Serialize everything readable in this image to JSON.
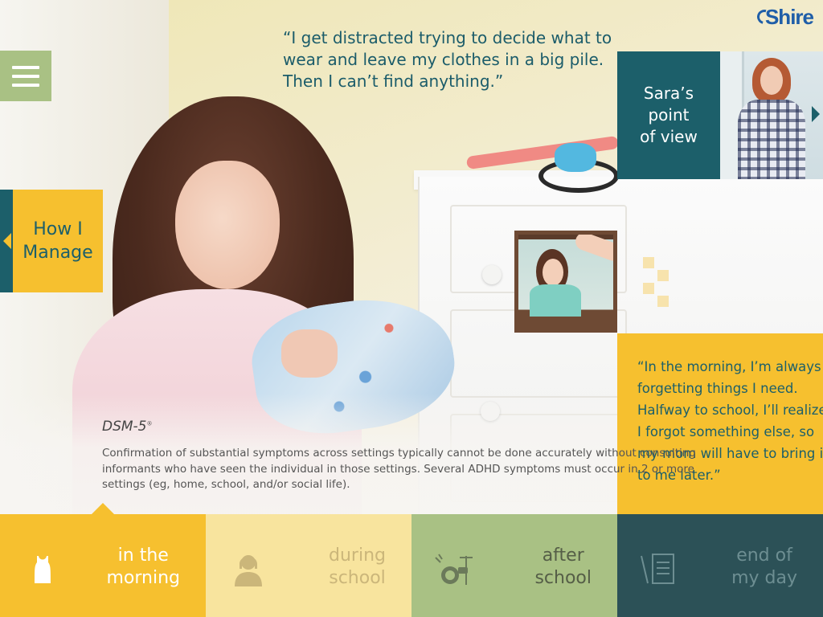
{
  "brand": {
    "logo_text": "Shire"
  },
  "top_quote": "“I get distracted trying to decide what to wear and leave my clothes in a big pile. Then I can’t find anything.”",
  "menu": {
    "icon": "hamburger-menu-icon"
  },
  "sara_panel": {
    "line1": "Sara’s",
    "line2": "point",
    "line3": "of view"
  },
  "manage_panel": {
    "line1": "How I",
    "line2": "Manage"
  },
  "morning_quote": "“In the morning, I’m always forgetting things I need. Halfway to school, I’ll realize I forgot something else, so my mom will have to bring it to me later.”",
  "dsm": {
    "title": "DSM-5",
    "title_mark": "®",
    "body": "Confirmation of substantial symptoms across settings typically cannot be done accurately without consulting informants who have seen the individual in those settings. Several ADHD symptoms must occur in 2 or more settings (eg, home, school, and/or social life)."
  },
  "nav": {
    "items": [
      {
        "line1": "in the",
        "line2": "morning",
        "icon": "tank-top-icon",
        "active": true
      },
      {
        "line1": "during",
        "line2": "school",
        "icon": "student-icon",
        "active": false
      },
      {
        "line1": "after",
        "line2": "school",
        "icon": "drum-kit-icon",
        "active": false
      },
      {
        "line1": "end of",
        "line2": "my day",
        "icon": "notebook-icon",
        "active": false
      }
    ]
  },
  "colors": {
    "teal": "#1c5f6a",
    "yellow": "#f6c02f",
    "green": "#a9c184",
    "pale_yellow": "#f8e49e",
    "dark_teal": "#2c5157"
  }
}
